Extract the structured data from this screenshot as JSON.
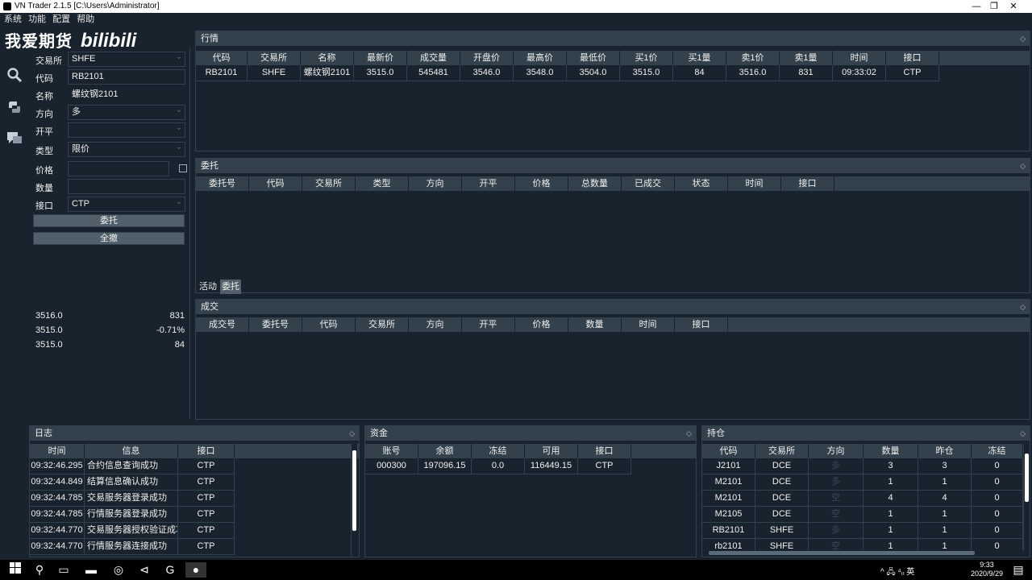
{
  "window": {
    "title": "VN Trader 2.1.5 [C:\\Users\\Administrator]",
    "minimize": "—",
    "restore": "❐",
    "close": "✕"
  },
  "menu": [
    "系统",
    "功能",
    "配置",
    "帮助"
  ],
  "watermark": {
    "text": "我爱期货",
    "brand": "bilibili"
  },
  "toolbar_icons": [
    "search-icon",
    "python-icon",
    "chat-icon"
  ],
  "trade": {
    "exchange_label": "交易所",
    "exchange_value": "SHFE",
    "symbol_label": "代码",
    "symbol_value": "RB2101",
    "name_label": "名称",
    "name_value": "螺纹钢2101",
    "direction_label": "方向",
    "direction_value": "多",
    "offset_label": "开平",
    "offset_value": "",
    "type_label": "类型",
    "type_value": "限价",
    "price_label": "价格",
    "price_value": "",
    "volume_label": "数量",
    "volume_value": "",
    "gateway_label": "接口",
    "gateway_value": "CTP",
    "send_button": "委托",
    "cancel_all_button": "全撤",
    "depth": [
      {
        "l": "3516.0",
        "r": "831"
      },
      {
        "l": "3515.0",
        "r": "-0.71%"
      },
      {
        "l": "3515.0",
        "r": "84"
      }
    ]
  },
  "tick": {
    "title": "行情",
    "headers": [
      "代码",
      "交易所",
      "名称",
      "最新价",
      "成交量",
      "开盘价",
      "最高价",
      "最低价",
      "买1价",
      "买1量",
      "卖1价",
      "卖1量",
      "时间",
      "接口"
    ],
    "rows": [
      [
        "RB2101",
        "SHFE",
        "螺纹钢2101",
        "3515.0",
        "545481",
        "3546.0",
        "3548.0",
        "3504.0",
        "3515.0",
        "84",
        "3516.0",
        "831",
        "09:33:02",
        "CTP"
      ]
    ]
  },
  "order": {
    "title": "委托",
    "headers": [
      "委托号",
      "代码",
      "交易所",
      "类型",
      "方向",
      "开平",
      "价格",
      "总数量",
      "已成交",
      "状态",
      "时间",
      "接口"
    ],
    "tabs": [
      "活动",
      "委托"
    ]
  },
  "trades": {
    "title": "成交",
    "headers": [
      "成交号",
      "委托号",
      "代码",
      "交易所",
      "方向",
      "开平",
      "价格",
      "数量",
      "时间",
      "接口"
    ]
  },
  "log": {
    "title": "日志",
    "headers": [
      "时间",
      "信息",
      "接口"
    ],
    "rows": [
      [
        "09:32:46.295",
        "合约信息查询成功",
        "CTP"
      ],
      [
        "09:32:44.849",
        "结算信息确认成功",
        "CTP"
      ],
      [
        "09:32:44.785",
        "交易服务器登录成功",
        "CTP"
      ],
      [
        "09:32:44.785",
        "行情服务器登录成功",
        "CTP"
      ],
      [
        "09:32:44.770",
        "交易服务器授权验证成功",
        "CTP"
      ],
      [
        "09:32:44.770",
        "行情服务器连接成功",
        "CTP"
      ]
    ]
  },
  "account": {
    "title": "资金",
    "headers": [
      "账号",
      "余额",
      "冻结",
      "可用",
      "接口"
    ],
    "rows": [
      [
        "000300",
        "197096.15",
        "0.0",
        "116449.15",
        "CTP"
      ]
    ]
  },
  "position": {
    "title": "持仓",
    "headers": [
      "代码",
      "交易所",
      "方向",
      "数量",
      "昨仓",
      "冻结"
    ],
    "rows": [
      [
        "J2101",
        "DCE",
        "多",
        "3",
        "3",
        "0"
      ],
      [
        "M2101",
        "DCE",
        "多",
        "1",
        "1",
        "0"
      ],
      [
        "M2101",
        "DCE",
        "空",
        "4",
        "4",
        "0"
      ],
      [
        "M2105",
        "DCE",
        "空",
        "1",
        "1",
        "0"
      ],
      [
        "RB2101",
        "SHFE",
        "多",
        "1",
        "1",
        "0"
      ],
      [
        "rb2101",
        "SHFE",
        "空",
        "1",
        "1",
        "0"
      ]
    ]
  },
  "taskbar": {
    "tray": "^ 🖧 ⁴ᵤ 英",
    "time": "9:33",
    "date": "2020/9/29"
  },
  "colors": {
    "background": "#19232d",
    "header": "#32414b",
    "button": "#505f69",
    "border": "#32414b"
  }
}
